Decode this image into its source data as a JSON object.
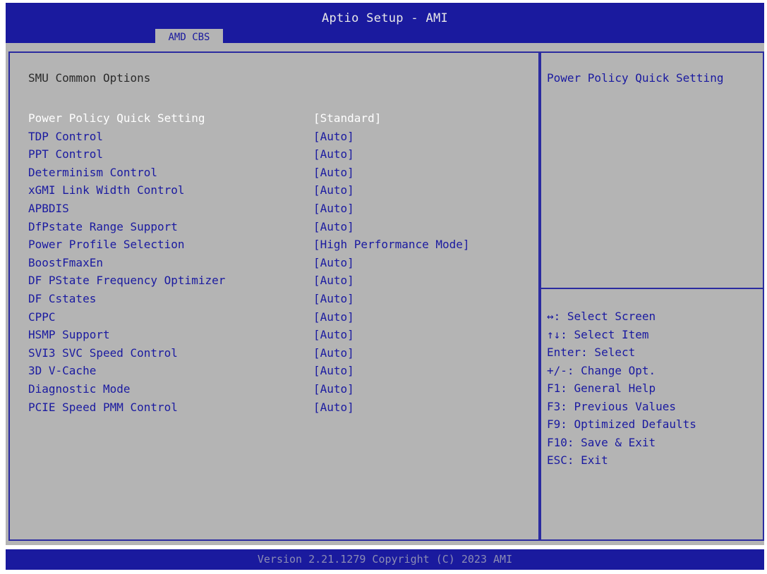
{
  "header": {
    "title": "Aptio Setup - AMI",
    "tab": "AMD CBS"
  },
  "main": {
    "section_title": "SMU Common Options",
    "items": [
      {
        "label": "Power Policy Quick Setting",
        "value": "[Standard]",
        "selected": true
      },
      {
        "label": "TDP Control",
        "value": "[Auto]"
      },
      {
        "label": "PPT Control",
        "value": "[Auto]"
      },
      {
        "label": "Determinism Control",
        "value": "[Auto]"
      },
      {
        "label": "xGMI Link Width Control",
        "value": "[Auto]"
      },
      {
        "label": "APBDIS",
        "value": "[Auto]"
      },
      {
        "label": "DfPstate Range Support",
        "value": "[Auto]"
      },
      {
        "label": "Power Profile Selection",
        "value": "[High Performance Mode]"
      },
      {
        "label": "BoostFmaxEn",
        "value": "[Auto]"
      },
      {
        "label": "DF PState Frequency Optimizer",
        "value": "[Auto]"
      },
      {
        "label": "DF Cstates",
        "value": "[Auto]"
      },
      {
        "label": "CPPC",
        "value": "[Auto]"
      },
      {
        "label": "HSMP Support",
        "value": "[Auto]"
      },
      {
        "label": "SVI3 SVC Speed Control",
        "value": "[Auto]"
      },
      {
        "label": "3D V-Cache",
        "value": "[Auto]"
      },
      {
        "label": "Diagnostic Mode",
        "value": "[Auto]"
      },
      {
        "label": "PCIE Speed PMM Control",
        "value": "[Auto]"
      }
    ]
  },
  "help": {
    "text": "Power Policy Quick Setting",
    "keys": [
      "↔: Select Screen",
      "↑↓: Select Item",
      "Enter: Select",
      "+/-: Change Opt.",
      "F1: General Help",
      "F3: Previous Values",
      "F9: Optimized Defaults",
      "F10: Save & Exit",
      "ESC: Exit"
    ]
  },
  "footer": {
    "text": "Version 2.21.1279 Copyright (C) 2023 AMI"
  },
  "colors": {
    "header_bg": "#1a1a9e",
    "screen_bg": "#b4b4b4",
    "item_text": "#1a1aa0",
    "selected_text": "#ffffff"
  }
}
